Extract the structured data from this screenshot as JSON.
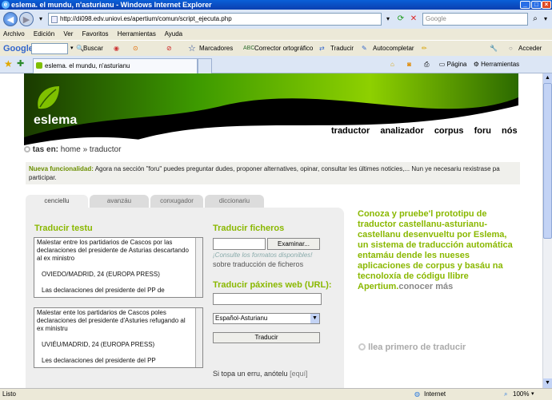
{
  "window": {
    "title": "eslema. el mundu, n'asturianu - Windows Internet Explorer"
  },
  "address_bar": {
    "url": "http://di098.edv.uniovi.es/apertium/comun/script_ejecuta.php",
    "search_placeholder": "Google"
  },
  "menu": [
    "Archivo",
    "Edición",
    "Ver",
    "Favoritos",
    "Herramientas",
    "Ayuda"
  ],
  "google_toolbar": {
    "logo": "Google",
    "buscar": "Buscar",
    "marcadores": "Marcadores",
    "corrector": "Corrector ortográfico",
    "traducir": "Traducir",
    "autocompletar": "Autocompletar",
    "acceder": "Acceder"
  },
  "tab": {
    "title": "eslema. el mundu, n'asturianu"
  },
  "command_bar": {
    "pagina": "Página",
    "herramientas": "Herramientas"
  },
  "site": {
    "logo": "eslema",
    "nav": [
      "traductor",
      "analizador",
      "corpus",
      "foru",
      "nós"
    ],
    "breadcrumb_prefix": "tas en:",
    "breadcrumb": "home » traductor",
    "notice_label": "Nueva funcionalidad:",
    "notice_text": "Agora na sección \"foru\" puedes preguntar dudes, proponer alternatives, opinar, consultar les últimes noticies,... Nun ye necesariu rexistrase pa participar."
  },
  "form_tabs": [
    "cenciellu",
    "avanzáu",
    "conxugador",
    "diccionariu"
  ],
  "translate_text": {
    "heading": "Traducir testu",
    "source_lines": [
      "Malestar entre los partidarios de Cascos por las declaraciones del presidente de Asturias descartando al ex ministro",
      "OVIEDO/MADRID, 24 (EUROPA PRESS)",
      "Las declaraciones del presidente del PP de"
    ],
    "target_lines": [
      "Malestar ente los partidarios de Cascos poles declaraciones del presidente d'Asturies refugando al ex ministru",
      "UVIÉU/MADRID, 24 (EUROPA PRESS)",
      "Les declaraciones del presidente del PP"
    ],
    "error_note": "Si topa un erru, anótelu",
    "error_link": "[equí]"
  },
  "translate_files": {
    "heading": "Traducir ficheros",
    "browse": "Examinar...",
    "formats_link": "¡Consulte los formatos disponibles!",
    "about": "sobre traducción de ficheros"
  },
  "translate_web": {
    "heading": "Traducir páxines web (URL):",
    "language_pair": "Español-Asturianu",
    "button": "Traducir"
  },
  "promo": {
    "text": "Conoza y pruebe'l prototipu de traductor castellanu-asturianu-castellanu desenvueltu por Eslema, un sistema de traducción automática entamáu dende les nueses aplicaciones de corpus y basáu na tecnoloxía de códigu llibre Apertium.",
    "link": "conocer más",
    "first_translate": "llea primero de traducir"
  },
  "status_bar": {
    "left": "Listo",
    "zone": "Internet",
    "zoom": "100%"
  },
  "colors": {
    "accent_green": "#8ab800",
    "ie_blue": "#0b3fb0"
  }
}
